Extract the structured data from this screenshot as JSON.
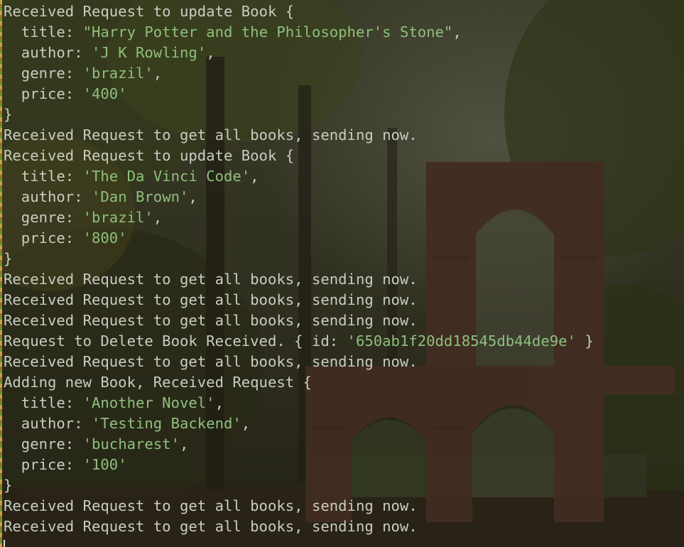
{
  "theme": {
    "text_color": "#c8ccc0",
    "string_color": "#8ec07c",
    "background_color": "#2a2b21"
  },
  "log": {
    "lines": [
      {
        "kind": "plain",
        "text": "Received Request to update Book {"
      },
      {
        "kind": "prop",
        "key": "  title: ",
        "value": "\"Harry Potter and the Philosopher's Stone\"",
        "tail": ","
      },
      {
        "kind": "prop",
        "key": "  author: ",
        "value": "'J K Rowling'",
        "tail": ","
      },
      {
        "kind": "prop",
        "key": "  genre: ",
        "value": "'brazil'",
        "tail": ","
      },
      {
        "kind": "prop",
        "key": "  price: ",
        "value": "'400'",
        "tail": ""
      },
      {
        "kind": "plain",
        "text": "}"
      },
      {
        "kind": "plain",
        "text": "Received Request to get all books, sending now."
      },
      {
        "kind": "plain",
        "text": "Received Request to update Book {"
      },
      {
        "kind": "prop",
        "key": "  title: ",
        "value": "'The Da Vinci Code'",
        "tail": ","
      },
      {
        "kind": "prop",
        "key": "  author: ",
        "value": "'Dan Brown'",
        "tail": ","
      },
      {
        "kind": "prop",
        "key": "  genre: ",
        "value": "'brazil'",
        "tail": ","
      },
      {
        "kind": "prop",
        "key": "  price: ",
        "value": "'800'",
        "tail": ""
      },
      {
        "kind": "plain",
        "text": "}"
      },
      {
        "kind": "plain",
        "text": "Received Request to get all books, sending now."
      },
      {
        "kind": "plain",
        "text": "Received Request to get all books, sending now."
      },
      {
        "kind": "plain",
        "text": "Received Request to get all books, sending now."
      },
      {
        "kind": "prop",
        "key": "Request to Delete Book Received. { id: ",
        "value": "'650ab1f20dd18545db44de9e'",
        "tail": " }"
      },
      {
        "kind": "plain",
        "text": "Received Request to get all books, sending now."
      },
      {
        "kind": "plain",
        "text": "Adding new Book, Received Request {"
      },
      {
        "kind": "prop",
        "key": "  title: ",
        "value": "'Another Novel'",
        "tail": ","
      },
      {
        "kind": "prop",
        "key": "  author: ",
        "value": "'Testing Backend'",
        "tail": ","
      },
      {
        "kind": "prop",
        "key": "  genre: ",
        "value": "'bucharest'",
        "tail": ","
      },
      {
        "kind": "prop",
        "key": "  price: ",
        "value": "'100'",
        "tail": ""
      },
      {
        "kind": "plain",
        "text": "}"
      },
      {
        "kind": "plain",
        "text": "Received Request to get all books, sending now."
      },
      {
        "kind": "plain",
        "text": "Received Request to get all books, sending now."
      },
      {
        "kind": "cursor"
      }
    ]
  }
}
